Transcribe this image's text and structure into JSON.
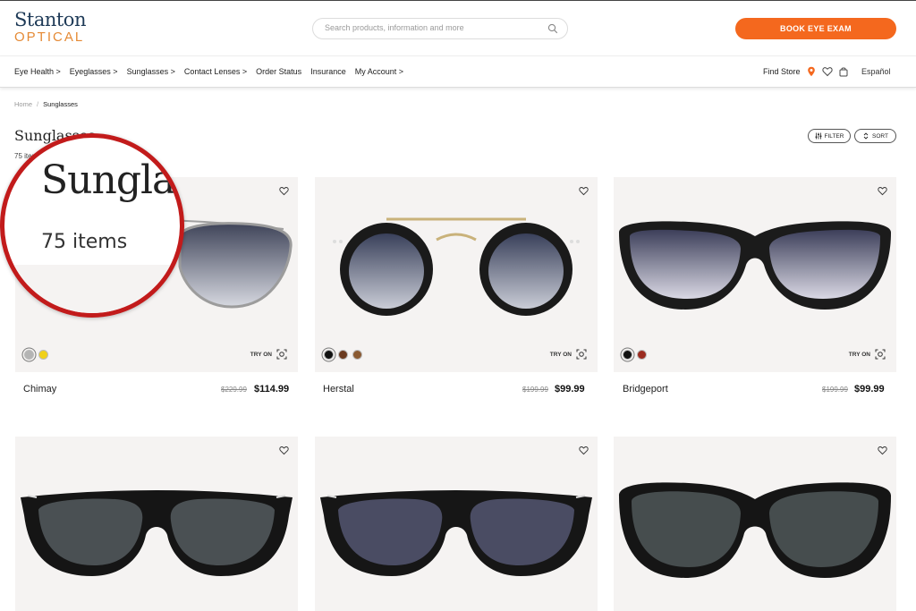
{
  "header": {
    "logo_main": "Stanton",
    "logo_sub": "OPTICAL",
    "search_placeholder": "Search products, information and more",
    "book_button": "BOOK EYE EXAM",
    "brand_accent": "#f4681e"
  },
  "nav": {
    "items": [
      "Eye Health >",
      "Eyeglasses >",
      "Sunglasses >",
      "Contact Lenses >",
      "Order Status",
      "Insurance",
      "My Account >"
    ],
    "find_store": "Find Store",
    "language": "Español"
  },
  "breadcrumb": {
    "home": "Home",
    "separator": "/",
    "current": "Sunglasses"
  },
  "page": {
    "title": "Sunglasses",
    "count": "75 items",
    "filter_label": "FILTER",
    "sort_label": "SORT"
  },
  "magnifier": {
    "title": "Sungla",
    "count": "75 items",
    "border_color": "#c21b1b"
  },
  "products": [
    {
      "name": "Chimay",
      "old_price": "$229.99",
      "price": "$114.99",
      "tryon": "TRY ON",
      "swatches": [
        "#b4b4b4",
        "#f0d11a"
      ]
    },
    {
      "name": "Herstal",
      "old_price": "$199.99",
      "price": "$99.99",
      "tryon": "TRY ON",
      "swatches": [
        "#111111",
        "#6b3a1f",
        "#8a5a32"
      ]
    },
    {
      "name": "Bridgeport",
      "old_price": "$199.99",
      "price": "$99.99",
      "tryon": "TRY ON",
      "swatches": [
        "#111111",
        "#9b2b20"
      ]
    },
    {
      "name": "",
      "old_price": "",
      "price": "",
      "tryon": "",
      "swatches": []
    },
    {
      "name": "",
      "old_price": "",
      "price": "",
      "tryon": "",
      "swatches": []
    },
    {
      "name": "",
      "old_price": "",
      "price": "",
      "tryon": "",
      "swatches": []
    }
  ]
}
